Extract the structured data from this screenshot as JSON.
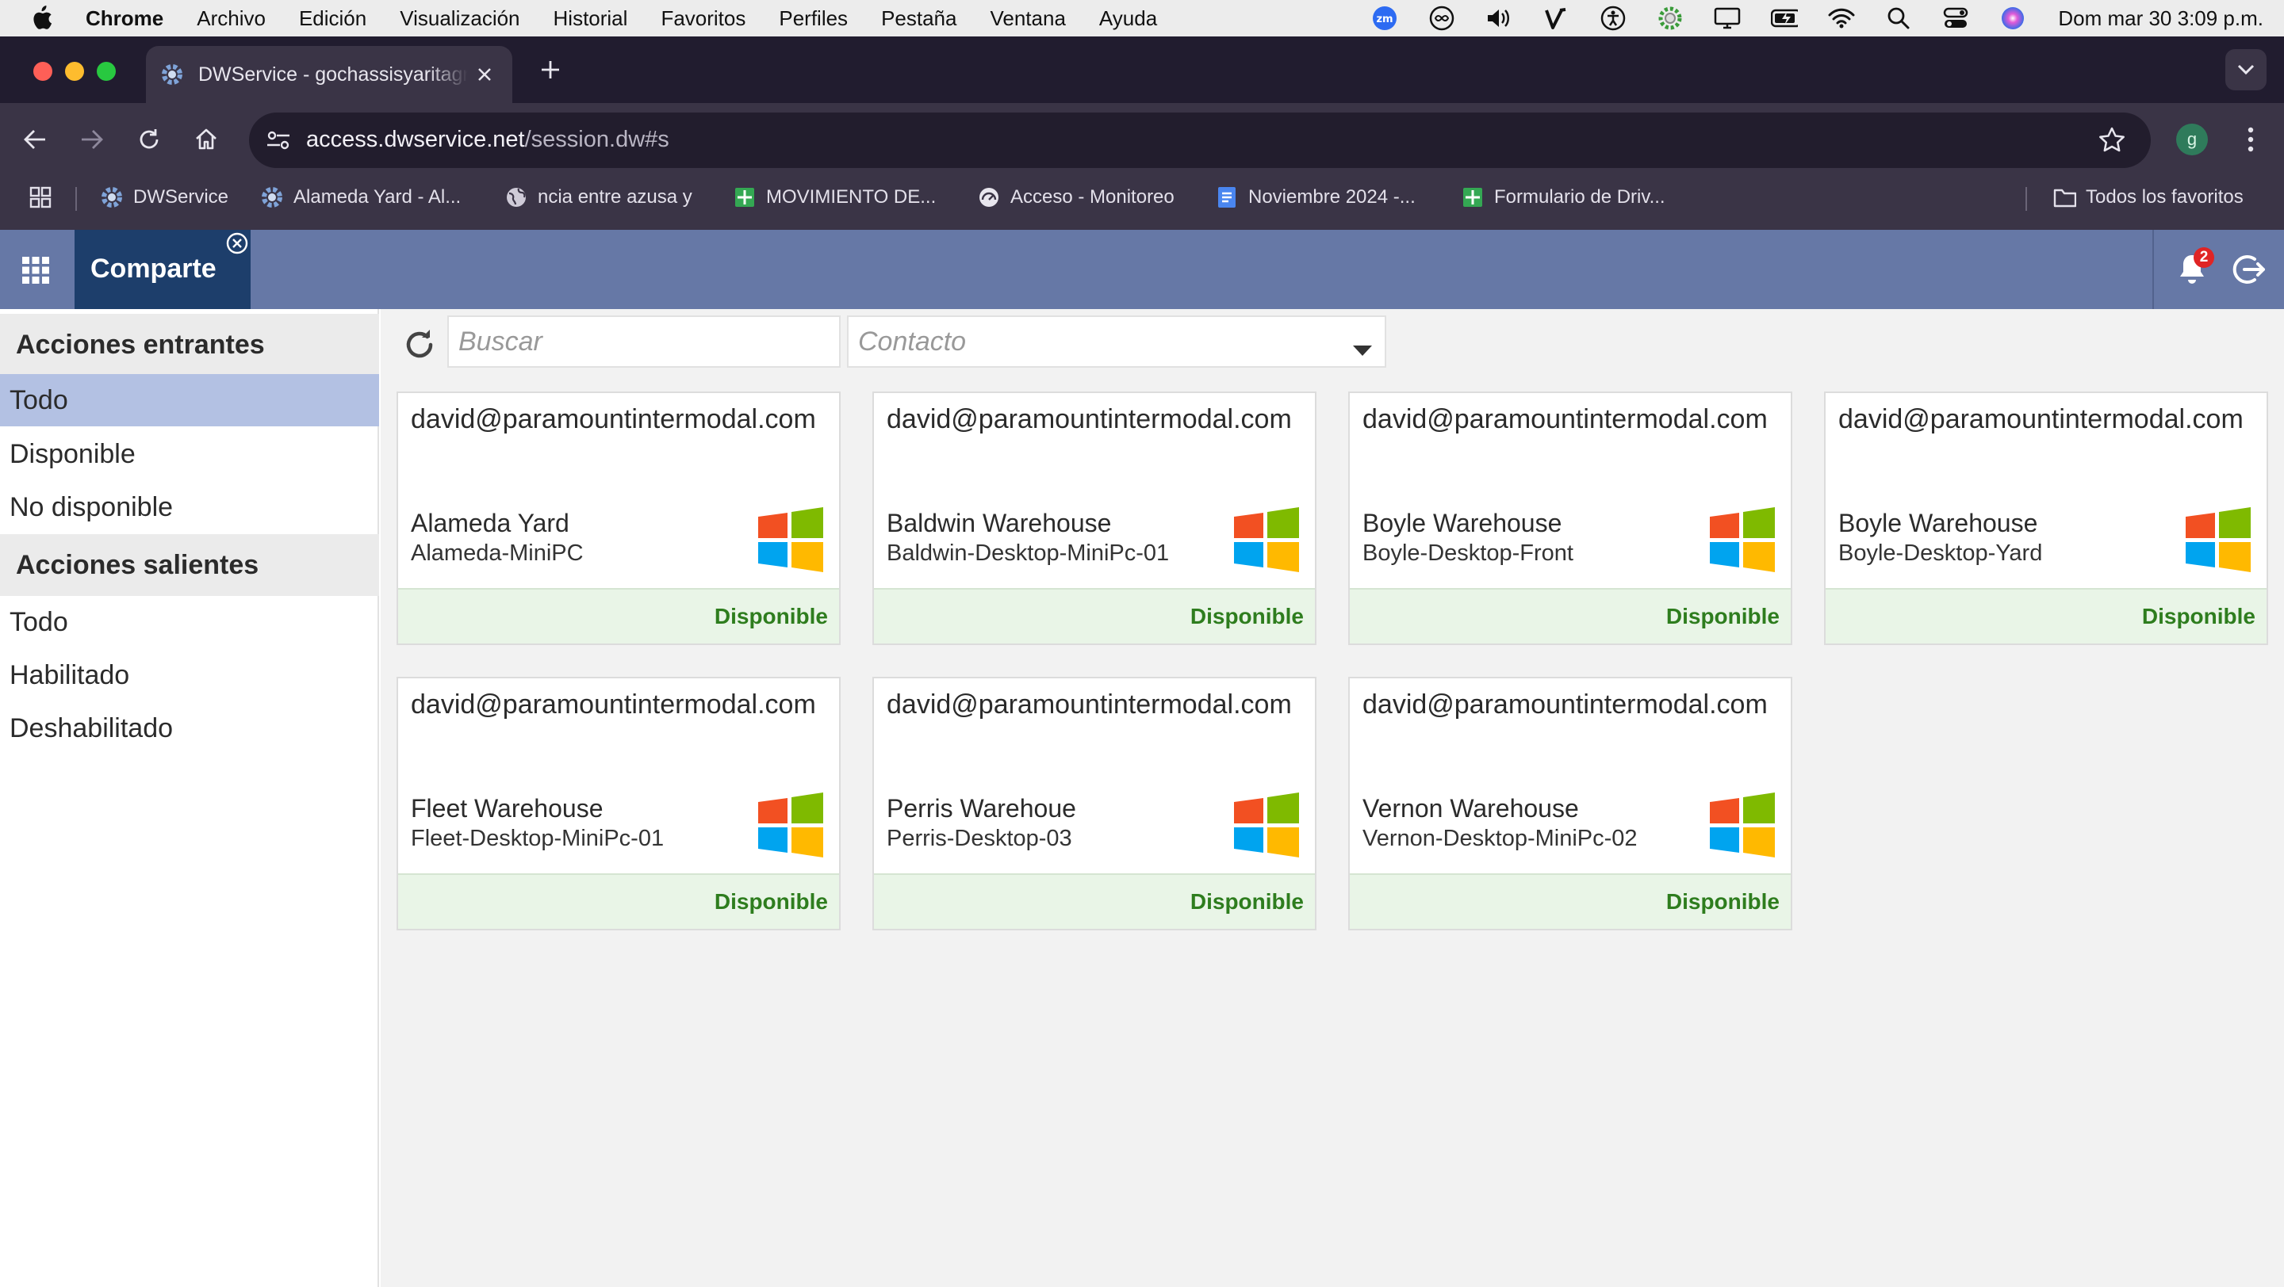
{
  "menubar": {
    "app": "Chrome",
    "items": [
      "Archivo",
      "Edición",
      "Visualización",
      "Historial",
      "Favoritos",
      "Perfiles",
      "Pestaña",
      "Ventana",
      "Ayuda"
    ],
    "clock": "Dom mar 30  3:09 p.m."
  },
  "browser": {
    "tab_title": "DWService - gochassisyaritagranados",
    "url_host": "access.dwservice.net",
    "url_path": "/session.dw#s",
    "profile_initial": "g",
    "bookmarks": [
      {
        "label": "DWService",
        "icon": "dwservice-gear-icon"
      },
      {
        "label": "Alameda Yard - Al...",
        "icon": "dwservice-gear-icon"
      },
      {
        "label": "ncia entre azusa y",
        "icon": "globe-icon"
      },
      {
        "label": "MOVIMIENTO DE...",
        "icon": "sheets-icon"
      },
      {
        "label": "Acceso - Monitoreo",
        "icon": "gauge-icon"
      },
      {
        "label": "Noviembre 2024 -...",
        "icon": "docs-icon"
      },
      {
        "label": "Formulario de Driv...",
        "icon": "sheets-icon"
      }
    ],
    "all_bookmarks": "Todos los favoritos"
  },
  "app": {
    "tab_label": "Comparte",
    "notification_count": "2"
  },
  "sidebar": {
    "incoming_header": "Acciones entrantes",
    "incoming": [
      "Todo",
      "Disponible",
      "No disponible"
    ],
    "outgoing_header": "Acciones salientes",
    "outgoing": [
      "Todo",
      "Habilitado",
      "Deshabilitado"
    ]
  },
  "filters": {
    "search_placeholder": "Buscar",
    "contact_placeholder": "Contacto"
  },
  "cards": [
    {
      "owner": "david@paramountintermodal.com",
      "name": "Alameda Yard",
      "host": "Alameda-MiniPC",
      "status": "Disponible"
    },
    {
      "owner": "david@paramountintermodal.com",
      "name": "Baldwin Warehouse",
      "host": "Baldwin-Desktop-MiniPc-01",
      "status": "Disponible"
    },
    {
      "owner": "david@paramountintermodal.com",
      "name": "Boyle Warehouse",
      "host": "Boyle-Desktop-Front",
      "status": "Disponible"
    },
    {
      "owner": "david@paramountintermodal.com",
      "name": "Boyle Warehouse",
      "host": "Boyle-Desktop-Yard",
      "status": "Disponible"
    },
    {
      "owner": "david@paramountintermodal.com",
      "name": "Fleet Warehouse",
      "host": "Fleet-Desktop-MiniPc-01",
      "status": "Disponible"
    },
    {
      "owner": "david@paramountintermodal.com",
      "name": "Perris Warehoue",
      "host": "Perris-Desktop-03",
      "status": "Disponible"
    },
    {
      "owner": "david@paramountintermodal.com",
      "name": "Vernon Warehouse",
      "host": "Vernon-Desktop-MiniPc-02",
      "status": "Disponible"
    }
  ],
  "colors": {
    "app_header": "#6678a6",
    "app_tab_active": "#1d3e6b",
    "sidebar_active": "#b3c1e3",
    "status_available": "#2e7d1e",
    "card_footer": "#e9f5e7"
  }
}
